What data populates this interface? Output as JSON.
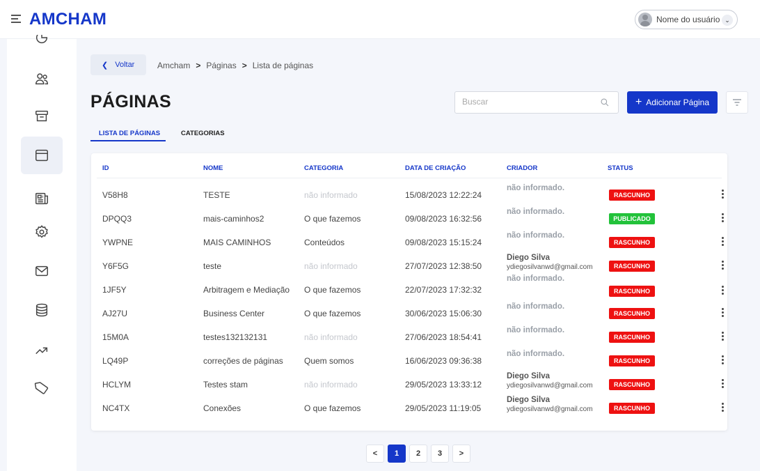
{
  "brand": {
    "logo": "AMCHAM",
    "accent": "#1537c9"
  },
  "user": {
    "name": "Nome do usuário"
  },
  "sidebar": {
    "items": [
      {
        "icon": "chart-partial-icon"
      },
      {
        "icon": "users-icon"
      },
      {
        "icon": "archive-icon"
      },
      {
        "icon": "browser-window-icon",
        "active": true
      },
      {
        "icon": "newspaper-icon"
      },
      {
        "icon": "gear-icon"
      },
      {
        "icon": "mail-icon"
      },
      {
        "icon": "database-icon"
      },
      {
        "icon": "trending-up-icon"
      },
      {
        "icon": "tag-icon"
      }
    ]
  },
  "breadcrumb": {
    "back_label": "Voltar",
    "items": [
      "Amcham",
      "Páginas",
      "Lista de páginas"
    ],
    "separator": ">"
  },
  "page": {
    "title": "PÁGINAS"
  },
  "search": {
    "placeholder": "Buscar"
  },
  "toolbar": {
    "add_label": "Adicionar Página",
    "add_plus": "+"
  },
  "tabs": [
    {
      "label": "LISTA DE PÁGINAS",
      "active": true
    },
    {
      "label": "CATEGORIAS",
      "active": false
    }
  ],
  "table": {
    "headers": [
      "ID",
      "NOME",
      "CATEGORIA",
      "DATA DE CRIAÇÃO",
      "CRIADOR",
      "STATUS"
    ],
    "rows": [
      {
        "id": "V58H8",
        "name": "TESTE",
        "category": "não informado",
        "category_missing": true,
        "date": "15/08/2023 12:22:24",
        "creator": "não informado.",
        "creator_email": "",
        "status": "RASCUNHO"
      },
      {
        "id": "DPQQ3",
        "name": "mais-caminhos2",
        "category": "O que fazemos",
        "category_missing": false,
        "date": "09/08/2023 16:32:56",
        "creator": "não informado.",
        "creator_email": "",
        "status": "PUBLICADO"
      },
      {
        "id": "YWPNE",
        "name": "MAIS CAMINHOS",
        "category": "Conteúdos",
        "category_missing": false,
        "date": "09/08/2023 15:15:24",
        "creator": "não informado.",
        "creator_email": "",
        "status": "RASCUNHO"
      },
      {
        "id": "Y6F5G",
        "name": "teste",
        "category": "não informado",
        "category_missing": true,
        "date": "27/07/2023 12:38:50",
        "creator": "Diego Silva",
        "creator_email": "ydiegosilvanwd@gmail.com",
        "status": "RASCUNHO"
      },
      {
        "id": "1JF5Y",
        "name": "Arbitragem e Mediação",
        "category": "O que fazemos",
        "category_missing": false,
        "date": "22/07/2023 17:32:32",
        "creator": "não informado.",
        "creator_email": "",
        "status": "RASCUNHO"
      },
      {
        "id": "AJ27U",
        "name": "Business Center",
        "category": "O que fazemos",
        "category_missing": false,
        "date": "30/06/2023 15:06:30",
        "creator": "não informado.",
        "creator_email": "",
        "status": "RASCUNHO"
      },
      {
        "id": "15M0A",
        "name": "testes132132131",
        "category": "não informado",
        "category_missing": true,
        "date": "27/06/2023 18:54:41",
        "creator": "não informado.",
        "creator_email": "",
        "status": "RASCUNHO"
      },
      {
        "id": "LQ49P",
        "name": "correções de páginas",
        "category": "Quem somos",
        "category_missing": false,
        "date": "16/06/2023 09:36:38",
        "creator": "não informado.",
        "creator_email": "",
        "status": "RASCUNHO"
      },
      {
        "id": "HCLYM",
        "name": "Testes stam",
        "category": "não informado",
        "category_missing": true,
        "date": "29/05/2023 13:33:12",
        "creator": "Diego Silva",
        "creator_email": "ydiegosilvanwd@gmail.com",
        "status": "RASCUNHO"
      },
      {
        "id": "NC4TX",
        "name": "Conexões",
        "category": "O que fazemos",
        "category_missing": false,
        "date": "29/05/2023 11:19:05",
        "creator": "Diego Silva",
        "creator_email": "ydiegosilvanwd@gmail.com",
        "status": "RASCUNHO"
      }
    ]
  },
  "status_colors": {
    "RASCUNHO": "#ee1111",
    "PUBLICADO": "#22c23a"
  },
  "pagination": {
    "prev": "<",
    "pages": [
      "1",
      "2",
      "3"
    ],
    "current": "1",
    "next": ">"
  }
}
